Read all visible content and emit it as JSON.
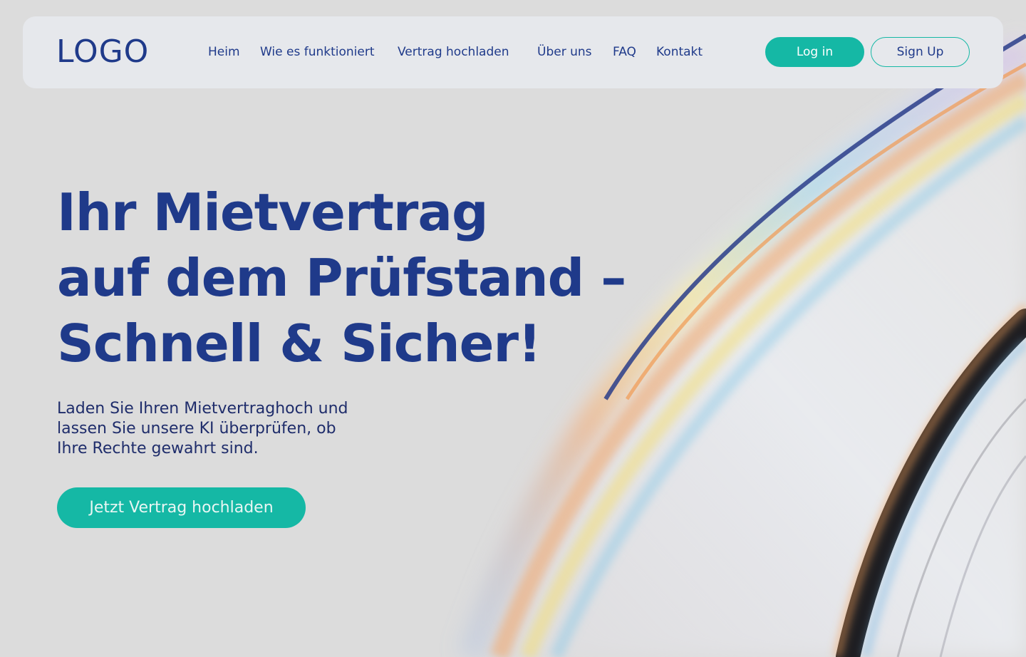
{
  "header": {
    "logo": "LOGO",
    "nav": [
      "Heim",
      "Wie es funktioniert",
      "Vertrag hochladen",
      "Über uns",
      "FAQ",
      "Kontakt"
    ],
    "login_label": "Log in",
    "signup_label": "Sign Up"
  },
  "hero": {
    "title_lines": [
      "Ihr Mietvertrag",
      "auf dem Prüfstand –",
      "Schnell & Sicher!"
    ],
    "subtitle_lines": [
      "Laden Sie Ihren Mietvertraghoch und",
      "lassen Sie unsere KI überprüfen, ob",
      "Ihre Rechte gewahrt sind."
    ],
    "cta_label": "Jetzt Vertrag hochladen"
  },
  "colors": {
    "brand_blue": "#1f3a8a",
    "accent_teal": "#15b8a5",
    "background": "#dcdcdc",
    "navbar_bg": "#e6e8ec"
  }
}
